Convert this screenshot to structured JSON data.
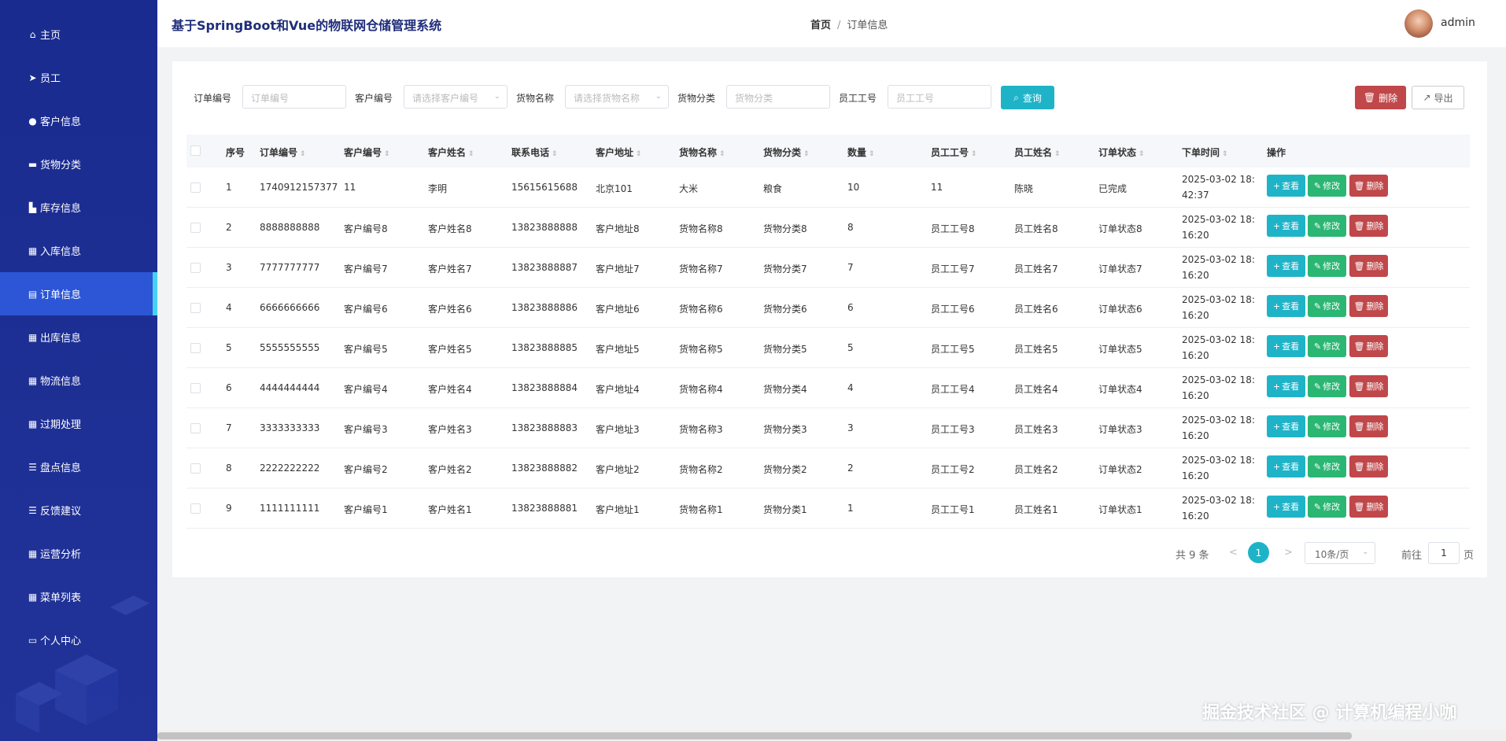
{
  "app": {
    "title": "基于SpringBoot和Vue的物联网仓储管理系统",
    "user": "admin",
    "breadcrumb": {
      "home": "首页",
      "separator": "/",
      "current": "订单信息"
    }
  },
  "sidebar": {
    "items": [
      {
        "icon": "home-icon",
        "glyph": "⌂",
        "label": "主页"
      },
      {
        "icon": "send-icon",
        "glyph": "➤",
        "label": "员工"
      },
      {
        "icon": "user-icon",
        "glyph": "●",
        "label": "客户信息"
      },
      {
        "icon": "briefcase-icon",
        "glyph": "▬",
        "label": "货物分类"
      },
      {
        "icon": "warehouse-icon",
        "glyph": "▙",
        "label": "库存信息"
      },
      {
        "icon": "grid-icon",
        "glyph": "▦",
        "label": "入库信息"
      },
      {
        "icon": "document-icon",
        "glyph": "▤",
        "label": "订单信息"
      },
      {
        "icon": "grid-icon",
        "glyph": "▦",
        "label": "出库信息"
      },
      {
        "icon": "grid-icon",
        "glyph": "▦",
        "label": "物流信息"
      },
      {
        "icon": "grid-icon",
        "glyph": "▦",
        "label": "过期处理"
      },
      {
        "icon": "list-icon",
        "glyph": "☰",
        "label": "盘点信息"
      },
      {
        "icon": "list-icon",
        "glyph": "☰",
        "label": "反馈建议"
      },
      {
        "icon": "grid-icon",
        "glyph": "▦",
        "label": "运营分析"
      },
      {
        "icon": "table-icon",
        "glyph": "▦",
        "label": "菜单列表"
      },
      {
        "icon": "id-card-icon",
        "glyph": "▭",
        "label": "个人中心"
      }
    ],
    "active_index": 6
  },
  "filters": {
    "order_no": {
      "label": "订单编号",
      "placeholder": "订单编号"
    },
    "customer_no": {
      "label": "客户编号",
      "placeholder": "请选择客户编号"
    },
    "goods_name": {
      "label": "货物名称",
      "placeholder": "请选择货物名称"
    },
    "goods_category": {
      "label": "货物分类",
      "placeholder": "货物分类"
    },
    "employee_no": {
      "label": "员工工号",
      "placeholder": "员工工号"
    },
    "query_label": "查询",
    "delete_label": "删除",
    "export_label": "导出"
  },
  "table": {
    "columns": [
      "序号",
      "订单编号",
      "客户编号",
      "客户姓名",
      "联系电话",
      "客户地址",
      "货物名称",
      "货物分类",
      "数量",
      "员工工号",
      "员工姓名",
      "订单状态",
      "下单时间",
      "操作"
    ],
    "rows": [
      [
        "1",
        "1740912157377",
        "11",
        "李明",
        "15615615688",
        "北京101",
        "大米",
        "粮食",
        "10",
        "11",
        "陈晓",
        "已完成",
        "2025-03-02 18:42:37"
      ],
      [
        "2",
        "8888888888",
        "客户编号8",
        "客户姓名8",
        "13823888888",
        "客户地址8",
        "货物名称8",
        "货物分类8",
        "8",
        "员工工号8",
        "员工姓名8",
        "订单状态8",
        "2025-03-02 18:16:20"
      ],
      [
        "3",
        "7777777777",
        "客户编号7",
        "客户姓名7",
        "13823888887",
        "客户地址7",
        "货物名称7",
        "货物分类7",
        "7",
        "员工工号7",
        "员工姓名7",
        "订单状态7",
        "2025-03-02 18:16:20"
      ],
      [
        "4",
        "6666666666",
        "客户编号6",
        "客户姓名6",
        "13823888886",
        "客户地址6",
        "货物名称6",
        "货物分类6",
        "6",
        "员工工号6",
        "员工姓名6",
        "订单状态6",
        "2025-03-02 18:16:20"
      ],
      [
        "5",
        "5555555555",
        "客户编号5",
        "客户姓名5",
        "13823888885",
        "客户地址5",
        "货物名称5",
        "货物分类5",
        "5",
        "员工工号5",
        "员工姓名5",
        "订单状态5",
        "2025-03-02 18:16:20"
      ],
      [
        "6",
        "4444444444",
        "客户编号4",
        "客户姓名4",
        "13823888884",
        "客户地址4",
        "货物名称4",
        "货物分类4",
        "4",
        "员工工号4",
        "员工姓名4",
        "订单状态4",
        "2025-03-02 18:16:20"
      ],
      [
        "7",
        "3333333333",
        "客户编号3",
        "客户姓名3",
        "13823888883",
        "客户地址3",
        "货物名称3",
        "货物分类3",
        "3",
        "员工工号3",
        "员工姓名3",
        "订单状态3",
        "2025-03-02 18:16:20"
      ],
      [
        "8",
        "2222222222",
        "客户编号2",
        "客户姓名2",
        "13823888882",
        "客户地址2",
        "货物名称2",
        "货物分类2",
        "2",
        "员工工号2",
        "员工姓名2",
        "订单状态2",
        "2025-03-02 18:16:20"
      ],
      [
        "9",
        "1111111111",
        "客户编号1",
        "客户姓名1",
        "13823888881",
        "客户地址1",
        "货物名称1",
        "货物分类1",
        "1",
        "员工工号1",
        "员工姓名1",
        "订单状态1",
        "2025-03-02 18:16:20"
      ]
    ],
    "actions": {
      "view": "查看",
      "edit": "修改",
      "delete": "删除"
    }
  },
  "pagination": {
    "total": "共 9 条",
    "prev": "<",
    "current_page": "1",
    "next": ">",
    "page_size": "10条/页",
    "goto_label": "前往",
    "goto_value": "1",
    "page_suffix": "页"
  },
  "watermark": "掘金技术社区 @ 计算机编程小咖",
  "colors": {
    "sidebar": "#1e2f97",
    "sidebar_active": "#2c56d6",
    "accent": "#1fb3c8",
    "edit": "#2bb673",
    "danger": "#c0474a"
  }
}
